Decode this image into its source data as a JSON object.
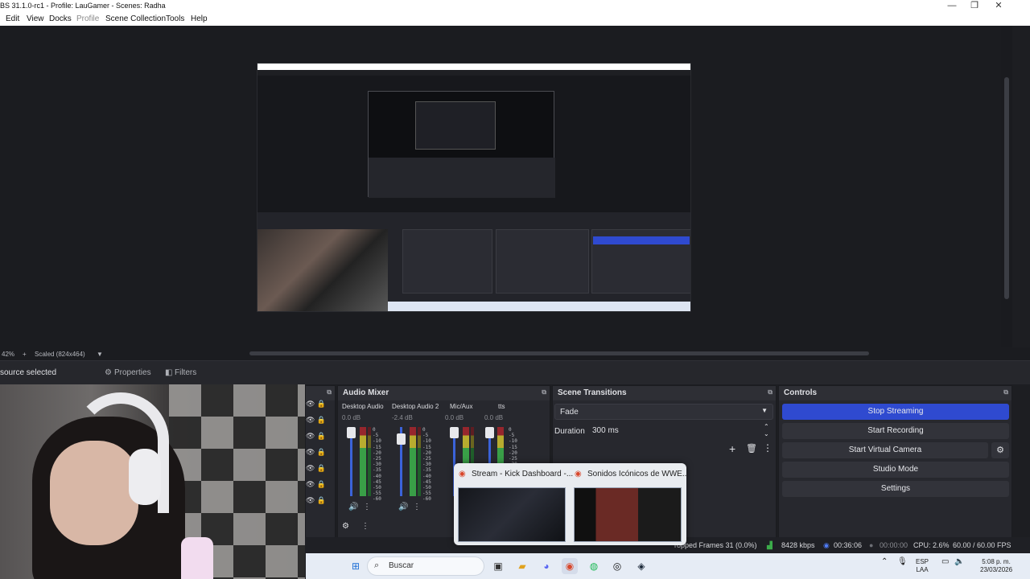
{
  "window": {
    "title": "BS 31.1.0-rc1 - Profile: LauGamer - Scenes: Radha",
    "minimize": "—",
    "maximize": "❐",
    "close": "✕"
  },
  "menu": [
    "Edit",
    "View",
    "Docks",
    "Profile",
    "Scene Collection",
    "Tools",
    "Help"
  ],
  "zoombar": {
    "zoom": "42%",
    "plus": "+",
    "scaled": "Scaled (824x464)",
    "dropdown": "▼"
  },
  "context": {
    "no_source": "source selected",
    "properties": "Properties",
    "filters": "Filters"
  },
  "audio_mixer": {
    "title": "Audio Mixer",
    "channels": [
      {
        "name": "Desktop Audio",
        "db": "0.0 dB"
      },
      {
        "name": "Desktop Audio 2",
        "db": "-2.4 dB"
      },
      {
        "name": "Mic/Aux",
        "db": "0.0 dB"
      },
      {
        "name": "tts",
        "db": "0.0 dB"
      }
    ],
    "ticks": "0\n-5\n-10\n-15\n-20\n-25\n-30\n-35\n-40\n-45\n-50\n-55\n-60",
    "ticks_short": "0\n-5\n-10\n-15\n-20\n-25\n-30"
  },
  "scene_transitions": {
    "title": "Scene Transitions",
    "transition": "Fade",
    "duration_label": "Duration",
    "duration_value": "300 ms"
  },
  "controls": {
    "title": "Controls",
    "stop_streaming": "Stop Streaming",
    "start_recording": "Start Recording",
    "start_virtual_camera": "Start Virtual Camera",
    "studio_mode": "Studio Mode",
    "settings": "Settings"
  },
  "status": {
    "dropped_frames": "ropped Frames 31 (0.0%)",
    "bitrate": "8428 kbps",
    "stream_time": "00:36:06",
    "rec_time": "00:00:00",
    "cpu": "CPU: 2.6%",
    "fps": "60.00 / 60.00 FPS"
  },
  "popup": {
    "tab1": "Stream - Kick Dashboard -...",
    "tab2": "Sonidos Icónicos de WWE..."
  },
  "taskbar": {
    "search": "Buscar",
    "lang_top": "ESP",
    "lang_bottom": "LAA",
    "time": "5:08 p. m.",
    "date": "23/03/2026"
  },
  "colors": {
    "accent": "#2f4ad0",
    "panel": "#27282e",
    "background": "#1d1e22"
  }
}
